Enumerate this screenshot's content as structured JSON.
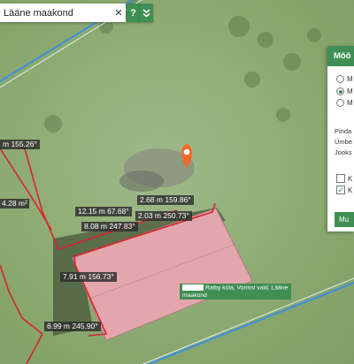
{
  "search": {
    "value": "Lääne maakond",
    "clear_icon": "×",
    "help_label": "?",
    "expand_icon": "»"
  },
  "measurements": {
    "labels": [
      "m 155.26°",
      "2.68 m 159.86°",
      "12.15 m 67.68°",
      "2.03 m 250.73°",
      "8.08 m 247.83°",
      "7.91 m 156.73°",
      "6.99 m 245.90°"
    ],
    "area": "4.28 m²"
  },
  "address": {
    "text": "Ralby küla, Vormsi vald, Lääne maakond"
  },
  "panel": {
    "title": "Mõõ",
    "options": [
      "M",
      "M",
      "M"
    ],
    "selected_index": 1,
    "info": [
      "Pinda",
      "Ümbe",
      "Jooks"
    ],
    "checkboxes": [
      {
        "label": "K",
        "checked": false
      },
      {
        "label": "K",
        "checked": true
      }
    ],
    "measure_button": "Mu"
  },
  "colors": {
    "accent": "#3f8f55",
    "measure_line": "#d9242b",
    "road": "#3a8fe0",
    "roof": "#e4a6ad",
    "marker": "#ef6a2e"
  }
}
